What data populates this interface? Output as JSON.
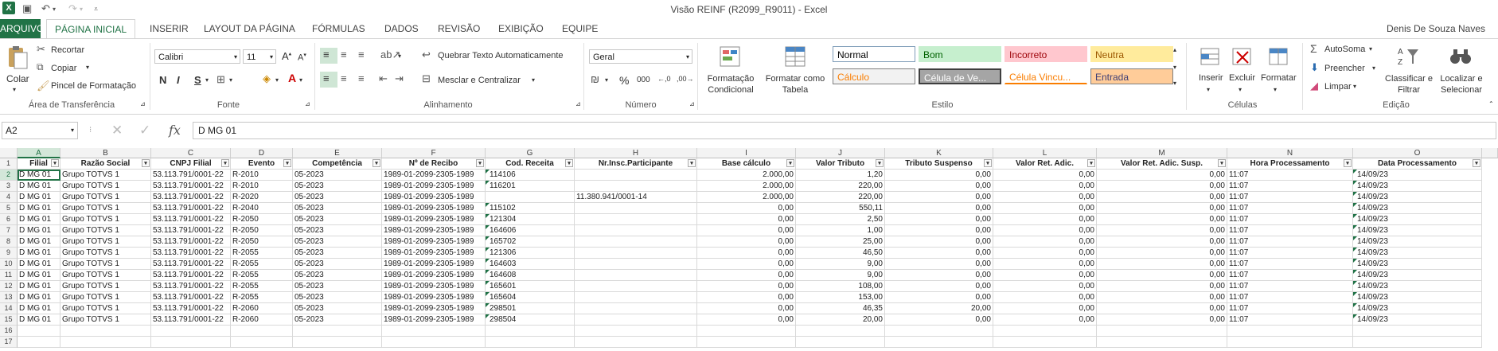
{
  "window": {
    "title": "Visão REINF (R2099_R9011) - Excel",
    "user": "Denis De Souza Naves",
    "file_tab": "ARQUIVO",
    "tabs": [
      "PÁGINA INICIAL",
      "INSERIR",
      "LAYOUT DA PÁGINA",
      "FÓRMULAS",
      "DADOS",
      "REVISÃO",
      "EXIBIÇÃO",
      "EQUIPE"
    ]
  },
  "ribbon": {
    "clipboard": {
      "paste": "Colar",
      "cut": "Recortar",
      "copy": "Copiar",
      "format_painter": "Pincel de Formatação",
      "label": "Área de Transferência"
    },
    "font": {
      "name": "Calibri",
      "size": "11",
      "label": "Fonte",
      "bold": "N",
      "italic": "I",
      "underline": "S"
    },
    "alignment": {
      "wrap": "Quebrar Texto Automaticamente",
      "merge": "Mesclar e Centralizar",
      "label": "Alinhamento"
    },
    "number": {
      "format": "Geral",
      "percent": "%",
      "thousands": "000",
      "label": "Número"
    },
    "styles": {
      "conditional": "Formatação Condicional",
      "format_table": "Formatar como Tabela",
      "cells": [
        {
          "text": "Normal",
          "bg": "#ffffff",
          "color": "#000000",
          "border": "#7f9db9"
        },
        {
          "text": "Bom",
          "bg": "#c6efce",
          "color": "#006100",
          "border": "#c6efce"
        },
        {
          "text": "Incorreto",
          "bg": "#ffc7ce",
          "color": "#9c0006",
          "border": "#ffc7ce"
        },
        {
          "text": "Neutra",
          "bg": "#ffeb9c",
          "color": "#9c5700",
          "border": "#ffeb9c"
        },
        {
          "text": "Cálculo",
          "bg": "#f2f2f2",
          "color": "#fa7d00",
          "border": "#7f7f7f"
        },
        {
          "text": "Célula de Ve...",
          "bg": "#a5a5a5",
          "color": "#ffffff",
          "border": "#3f3f3f"
        },
        {
          "text": "Célula Vincu...",
          "bg": "#ffffff",
          "color": "#fa7d00",
          "border": "#ffffff"
        },
        {
          "text": "Entrada",
          "bg": "#ffcc99",
          "color": "#3f3f76",
          "border": "#7f7f7f"
        }
      ],
      "label": "Estilo"
    },
    "cells": {
      "insert": "Inserir",
      "delete": "Excluir",
      "format": "Formatar",
      "label": "Células"
    },
    "editing": {
      "autosum": "AutoSoma",
      "fill": "Preencher",
      "clear": "Limpar",
      "sort": "Classificar e Filtrar",
      "find": "Localizar e Selecionar",
      "label": "Edição"
    }
  },
  "formula_bar": {
    "name_box": "A2",
    "fx": "fx",
    "content": "D MG 01"
  },
  "sheet": {
    "columns": [
      "A",
      "B",
      "C",
      "D",
      "E",
      "F",
      "G",
      "H",
      "I",
      "J",
      "K",
      "L",
      "M",
      "N",
      "O"
    ],
    "headers": [
      "Filial",
      "Razão Social",
      "CNPJ Filial",
      "Evento",
      "Competência",
      "Nº de Recibo",
      "Cod. Receita",
      "Nr.Insc.Participante",
      "Base cálculo",
      "Valor Tributo",
      "Tributo Suspenso",
      "Valor Ret. Adic.",
      "Valor Ret. Adic. Susp.",
      "Hora Processamento",
      "Data Processamento"
    ],
    "rows": [
      [
        "D MG 01",
        "Grupo TOTVS 1",
        "53.113.791/0001-22",
        "R-2010",
        "05-2023",
        "1989-01-2099-2305-1989",
        "114106",
        "",
        "2.000,00",
        "1,20",
        "0,00",
        "0,00",
        "0,00",
        "11:07",
        "14/09/23"
      ],
      [
        "D MG 01",
        "Grupo TOTVS 1",
        "53.113.791/0001-22",
        "R-2010",
        "05-2023",
        "1989-01-2099-2305-1989",
        "116201",
        "",
        "2.000,00",
        "220,00",
        "0,00",
        "0,00",
        "0,00",
        "11:07",
        "14/09/23"
      ],
      [
        "D MG 01",
        "Grupo TOTVS 1",
        "53.113.791/0001-22",
        "R-2020",
        "05-2023",
        "1989-01-2099-2305-1989",
        "",
        "11.380.941/0001-14",
        "2.000,00",
        "220,00",
        "0,00",
        "0,00",
        "0,00",
        "11:07",
        "14/09/23"
      ],
      [
        "D MG 01",
        "Grupo TOTVS 1",
        "53.113.791/0001-22",
        "R-2040",
        "05-2023",
        "1989-01-2099-2305-1989",
        "115102",
        "",
        "0,00",
        "550,11",
        "0,00",
        "0,00",
        "0,00",
        "11:07",
        "14/09/23"
      ],
      [
        "D MG 01",
        "Grupo TOTVS 1",
        "53.113.791/0001-22",
        "R-2050",
        "05-2023",
        "1989-01-2099-2305-1989",
        "121304",
        "",
        "0,00",
        "2,50",
        "0,00",
        "0,00",
        "0,00",
        "11:07",
        "14/09/23"
      ],
      [
        "D MG 01",
        "Grupo TOTVS 1",
        "53.113.791/0001-22",
        "R-2050",
        "05-2023",
        "1989-01-2099-2305-1989",
        "164606",
        "",
        "0,00",
        "1,00",
        "0,00",
        "0,00",
        "0,00",
        "11:07",
        "14/09/23"
      ],
      [
        "D MG 01",
        "Grupo TOTVS 1",
        "53.113.791/0001-22",
        "R-2050",
        "05-2023",
        "1989-01-2099-2305-1989",
        "165702",
        "",
        "0,00",
        "25,00",
        "0,00",
        "0,00",
        "0,00",
        "11:07",
        "14/09/23"
      ],
      [
        "D MG 01",
        "Grupo TOTVS 1",
        "53.113.791/0001-22",
        "R-2055",
        "05-2023",
        "1989-01-2099-2305-1989",
        "121306",
        "",
        "0,00",
        "46,50",
        "0,00",
        "0,00",
        "0,00",
        "11:07",
        "14/09/23"
      ],
      [
        "D MG 01",
        "Grupo TOTVS 1",
        "53.113.791/0001-22",
        "R-2055",
        "05-2023",
        "1989-01-2099-2305-1989",
        "164603",
        "",
        "0,00",
        "9,00",
        "0,00",
        "0,00",
        "0,00",
        "11:07",
        "14/09/23"
      ],
      [
        "D MG 01",
        "Grupo TOTVS 1",
        "53.113.791/0001-22",
        "R-2055",
        "05-2023",
        "1989-01-2099-2305-1989",
        "164608",
        "",
        "0,00",
        "9,00",
        "0,00",
        "0,00",
        "0,00",
        "11:07",
        "14/09/23"
      ],
      [
        "D MG 01",
        "Grupo TOTVS 1",
        "53.113.791/0001-22",
        "R-2055",
        "05-2023",
        "1989-01-2099-2305-1989",
        "165601",
        "",
        "0,00",
        "108,00",
        "0,00",
        "0,00",
        "0,00",
        "11:07",
        "14/09/23"
      ],
      [
        "D MG 01",
        "Grupo TOTVS 1",
        "53.113.791/0001-22",
        "R-2055",
        "05-2023",
        "1989-01-2099-2305-1989",
        "165604",
        "",
        "0,00",
        "153,00",
        "0,00",
        "0,00",
        "0,00",
        "11:07",
        "14/09/23"
      ],
      [
        "D MG 01",
        "Grupo TOTVS 1",
        "53.113.791/0001-22",
        "R-2060",
        "05-2023",
        "1989-01-2099-2305-1989",
        "298501",
        "",
        "0,00",
        "46,35",
        "20,00",
        "0,00",
        "0,00",
        "11:07",
        "14/09/23"
      ],
      [
        "D MG 01",
        "Grupo TOTVS 1",
        "53.113.791/0001-22",
        "R-2060",
        "05-2023",
        "1989-01-2099-2305-1989",
        "298504",
        "",
        "0,00",
        "20,00",
        "0,00",
        "0,00",
        "0,00",
        "11:07",
        "14/09/23"
      ]
    ],
    "row_numbers": [
      "1",
      "2",
      "3",
      "4",
      "5",
      "6",
      "7",
      "8",
      "9",
      "10",
      "11",
      "12",
      "13",
      "14",
      "15",
      "16",
      "17"
    ]
  }
}
